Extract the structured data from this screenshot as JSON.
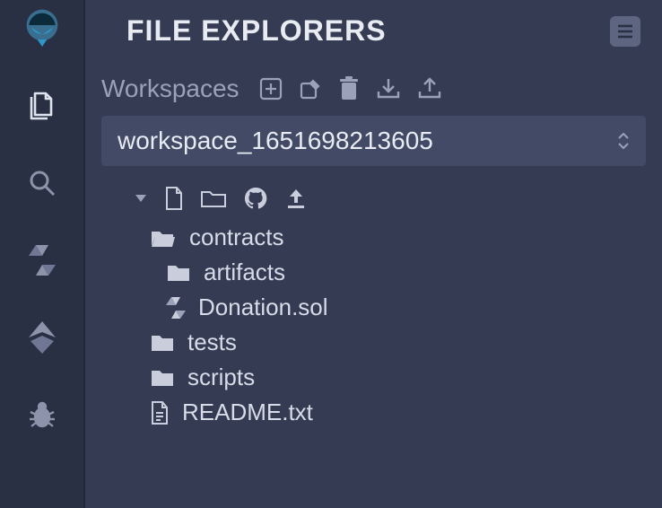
{
  "panel": {
    "title": "FILE EXPLORERS",
    "workspaces_label": "Workspaces"
  },
  "workspace": {
    "selected": "workspace_1651698213605"
  },
  "tree": {
    "items": [
      {
        "name": "contracts",
        "icon": "folder-open",
        "indent": 1
      },
      {
        "name": "artifacts",
        "icon": "folder",
        "indent": 2
      },
      {
        "name": "Donation.sol",
        "icon": "solidity",
        "indent": 2
      },
      {
        "name": "tests",
        "icon": "folder",
        "indent": 1
      },
      {
        "name": "scripts",
        "icon": "folder",
        "indent": 1
      },
      {
        "name": "README.txt",
        "icon": "file-text",
        "indent": 1
      }
    ]
  }
}
